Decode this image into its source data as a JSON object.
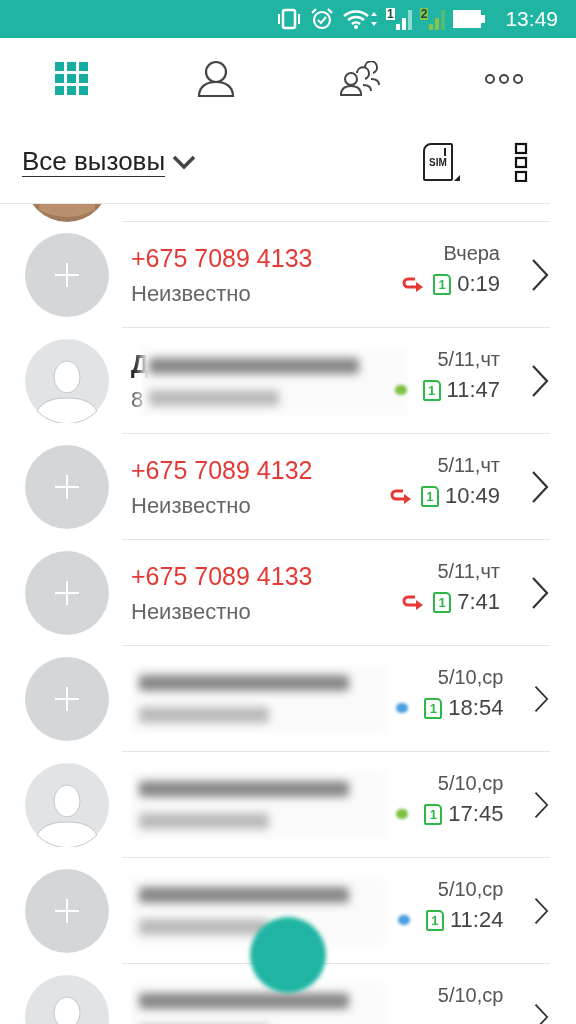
{
  "status_bar": {
    "signals": [
      {
        "label": "1",
        "color": "#ffffff"
      },
      {
        "label": "2",
        "color": "#8bc34a"
      }
    ],
    "time": "13:49"
  },
  "tabs": [
    {
      "kind": "keypad",
      "selected": true
    },
    {
      "kind": "contact",
      "selected": false
    },
    {
      "kind": "groups",
      "selected": false
    },
    {
      "kind": "more",
      "selected": false
    }
  ],
  "filter": {
    "label": "Все вызовы",
    "sim_label": "SIM"
  },
  "calls": [
    {
      "avatar": {
        "kind": "unknown"
      },
      "name": "+675 7089 4133",
      "number": "Неизвестно",
      "date": "Вчера",
      "call": {
        "kind": "missed"
      },
      "sim": "1",
      "duration": "0:19"
    },
    {
      "avatar": {
        "kind": "person"
      },
      "name": "Д",
      "number": "8",
      "blurred": true,
      "date": "5/11,чт",
      "call": {
        "kind": "incoming"
      },
      "sim": "1",
      "duration": "11:47"
    },
    {
      "avatar": {
        "kind": "unknown"
      },
      "name": "+675 7089 4132",
      "number": "Неизвестно",
      "date": "5/11,чт",
      "call": {
        "kind": "missed"
      },
      "sim": "1",
      "duration": "10:49"
    },
    {
      "avatar": {
        "kind": "unknown"
      },
      "name": "+675 7089 4133",
      "number": "Неизвестно",
      "date": "5/11,чт",
      "call": {
        "kind": "missed"
      },
      "sim": "1",
      "duration": "7:41"
    },
    {
      "avatar": {
        "kind": "unknown"
      },
      "blurred": true,
      "date": "5/10,ср",
      "call": {
        "kind": "outgoing"
      },
      "sim": "1",
      "duration": "18:54"
    },
    {
      "avatar": {
        "kind": "person"
      },
      "blurred": true,
      "date": "5/10,ср",
      "call": {
        "kind": "incoming"
      },
      "sim": "1",
      "duration": "17:45"
    },
    {
      "avatar": {
        "kind": "unknown"
      },
      "blurred": true,
      "date": "5/10,ср",
      "call": {
        "kind": "outgoing"
      },
      "sim": "1",
      "duration": "11:24"
    },
    {
      "avatar": {
        "kind": "person"
      },
      "blurred": true,
      "date": "5/10,ср"
    }
  ]
}
